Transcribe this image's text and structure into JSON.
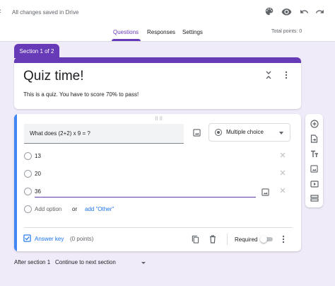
{
  "header": {
    "back_glyph": "‹",
    "save_status": "All changes saved in Drive",
    "icons": [
      "palette-icon",
      "eye-icon",
      "undo-icon",
      "redo-icon",
      "more-vert-icon"
    ]
  },
  "tabs": [
    {
      "label": "Questions",
      "active": true
    },
    {
      "label": "Responses",
      "active": false
    },
    {
      "label": "Settings",
      "active": false
    }
  ],
  "total_points": "Total points: 0",
  "section_tag": "Section 1 of 2",
  "form": {
    "title": "Quiz time!",
    "description": "This is a quiz. You have to score 70% to pass!"
  },
  "question": {
    "text": "What does (2+2) x 9 = ?",
    "type_label": "Multiple choice",
    "options": [
      "13",
      "20",
      "36"
    ],
    "add_option_label": "Add option",
    "or_label": "or",
    "add_other_label": "add \"Other\"",
    "answer_key_label": "Answer key",
    "points_label": "(0 points)",
    "required_label": "Required",
    "required": false
  },
  "toolbar_icons": [
    "add-question-icon",
    "import-questions-icon",
    "add-title-icon",
    "add-image-icon",
    "add-video-icon",
    "add-section-icon"
  ],
  "after_section": {
    "label": "After section 1",
    "value": "Continue to next section"
  },
  "colors": {
    "accent": "#673ab7",
    "background": "#f0ebf8",
    "active_card_border": "#4285f4",
    "link": "#1a73e8"
  }
}
